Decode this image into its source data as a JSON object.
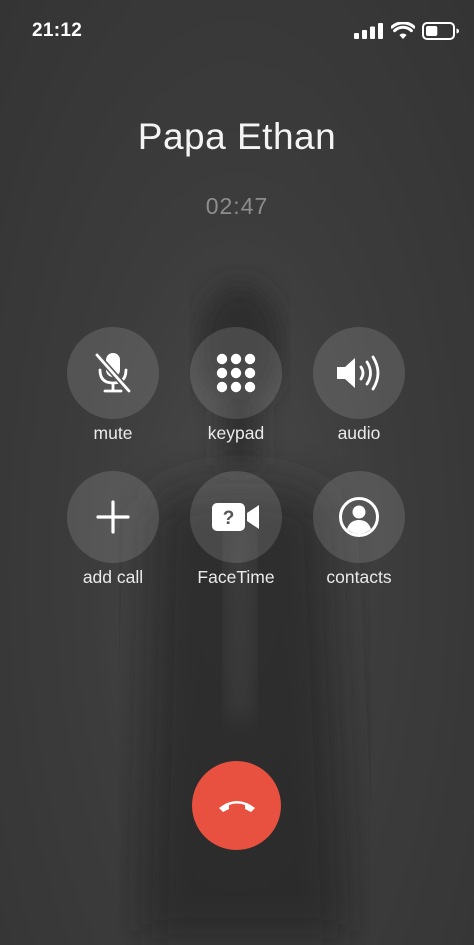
{
  "status_bar": {
    "time": "21:12",
    "icons": [
      "cellular-signal-icon",
      "wifi-icon",
      "battery-icon"
    ],
    "battery_level": 0.45
  },
  "call": {
    "caller_name": "Papa Ethan",
    "duration": "02:47"
  },
  "controls": [
    {
      "label": "mute",
      "icon": "microphone-slash-icon"
    },
    {
      "label": "keypad",
      "icon": "keypad-icon"
    },
    {
      "label": "audio",
      "icon": "speaker-icon"
    },
    {
      "label": "add call",
      "icon": "plus-icon"
    },
    {
      "label": "FaceTime",
      "icon": "facetime-unavailable-icon"
    },
    {
      "label": "contacts",
      "icon": "contact-person-icon"
    }
  ],
  "end_call": {
    "icon": "phone-hangup-icon"
  },
  "colors": {
    "background": "#3c3c3c",
    "button_fill": "rgba(255,255,255,0.13)",
    "end_call_red": "#e8503f",
    "timer_gray": "#8d8d8d"
  }
}
